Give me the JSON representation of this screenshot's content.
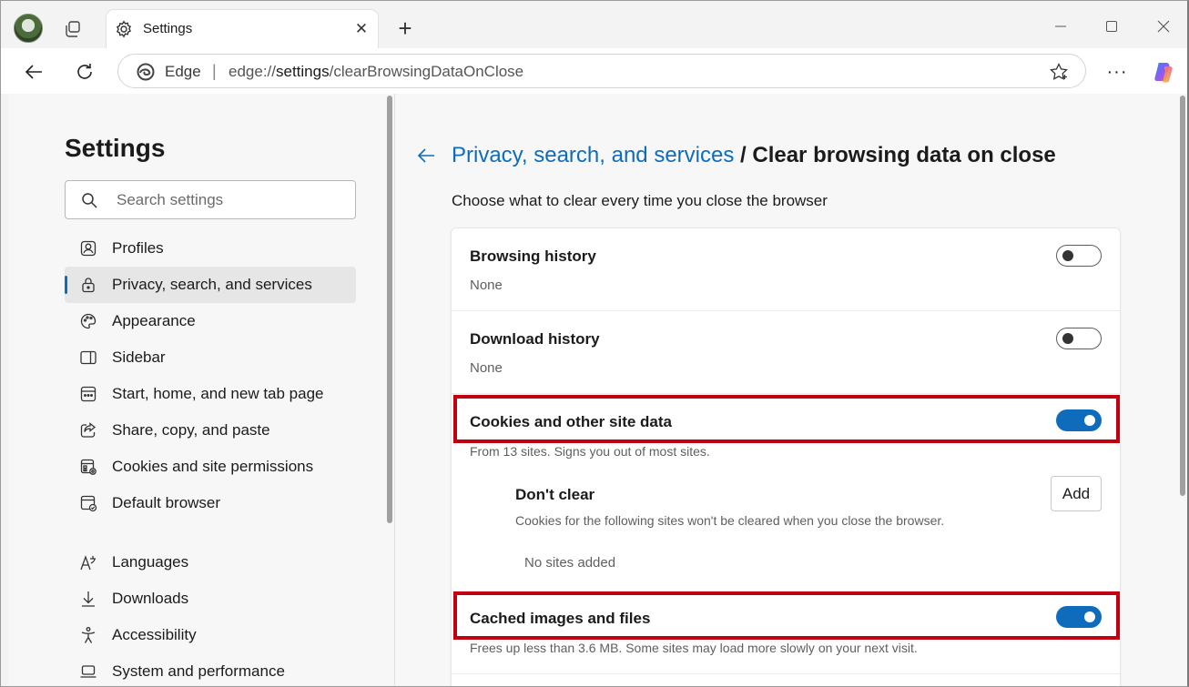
{
  "browser": {
    "tab": {
      "title": "Settings",
      "icon": "gear-icon"
    },
    "address": {
      "site_label": "Edge",
      "separator": "|",
      "url_prefix": "edge://",
      "url_host": "settings",
      "url_path": "/clearBrowsingDataOnClose"
    },
    "toolbar": {
      "more_label": "···"
    }
  },
  "sidebar": {
    "title": "Settings",
    "search_placeholder": "Search settings",
    "items": [
      {
        "label": "Profiles",
        "icon": "profile-icon",
        "active": false
      },
      {
        "label": "Privacy, search, and services",
        "icon": "lock-icon",
        "active": true
      },
      {
        "label": "Appearance",
        "icon": "palette-icon",
        "active": false
      },
      {
        "label": "Sidebar",
        "icon": "sidebar-icon",
        "active": false
      },
      {
        "label": "Start, home, and new tab page",
        "icon": "home-grid-icon",
        "active": false
      },
      {
        "label": "Share, copy, and paste",
        "icon": "share-icon",
        "active": false
      },
      {
        "label": "Cookies and site permissions",
        "icon": "cookies-icon",
        "active": false
      },
      {
        "label": "Default browser",
        "icon": "browser-icon",
        "active": false
      }
    ],
    "items2": [
      {
        "label": "Languages",
        "icon": "languages-icon"
      },
      {
        "label": "Downloads",
        "icon": "download-icon"
      },
      {
        "label": "Accessibility",
        "icon": "accessibility-icon"
      },
      {
        "label": "System and performance",
        "icon": "laptop-icon"
      }
    ]
  },
  "main": {
    "breadcrumb_link": "Privacy, search, and services",
    "breadcrumb_sep": " / ",
    "breadcrumb_current": "Clear browsing data on close",
    "subtitle": "Choose what to clear every time you close the browser",
    "rows": [
      {
        "title": "Browsing history",
        "sub": "None",
        "enabled": false
      },
      {
        "title": "Download history",
        "sub": "None",
        "enabled": false
      },
      {
        "title": "Cookies and other site data",
        "sub": "From 13 sites. Signs you out of most sites.",
        "enabled": true
      },
      {
        "title": "Cached images and files",
        "sub": "Frees up less than 3.6 MB. Some sites may load more slowly on your next visit.",
        "enabled": true
      }
    ],
    "dont_clear": {
      "title": "Don't clear",
      "desc": "Cookies for the following sites won't be cleared when you close the browser.",
      "add_label": "Add",
      "empty_note": "No sites added"
    },
    "accent_color": "#0f6cbd",
    "highlight_color": "#c00010"
  }
}
